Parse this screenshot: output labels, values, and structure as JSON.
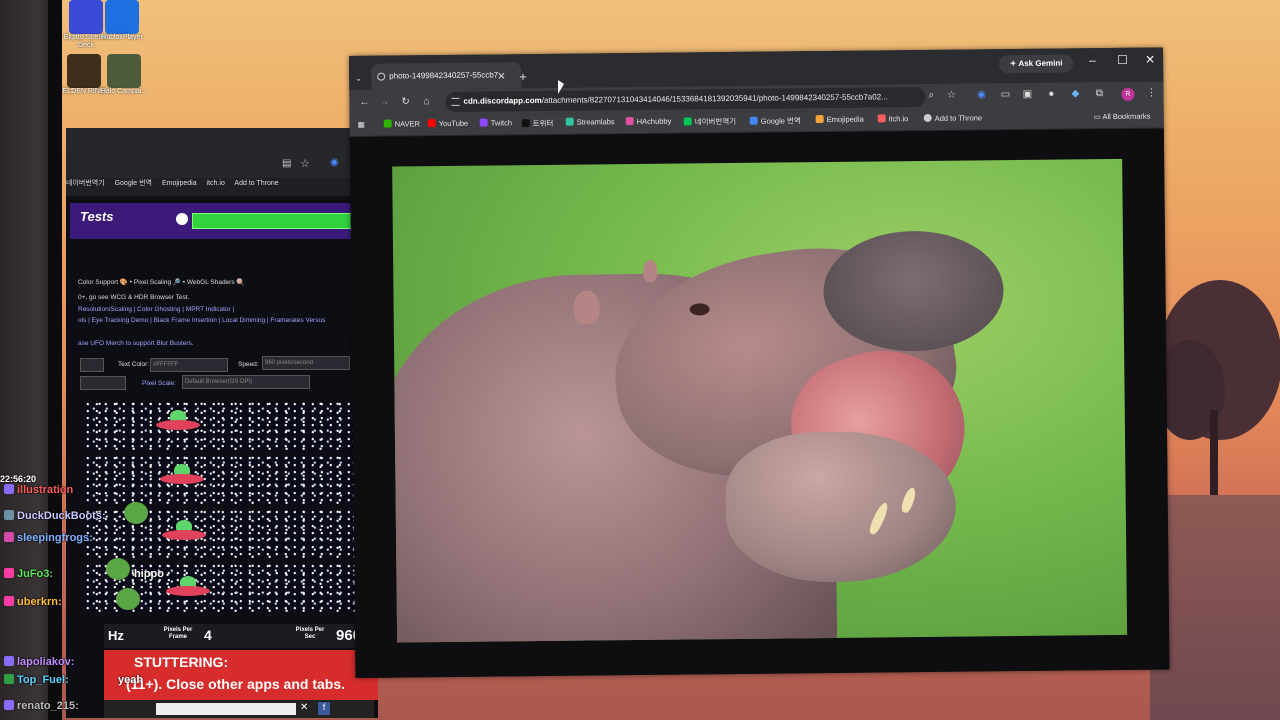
{
  "desktop": {
    "icons": [
      {
        "label": "Elgato Stream Deck"
      },
      {
        "label": "RobloxPlayer"
      },
      {
        "label": "ELDEN RING"
      },
      {
        "label": "Halo Campai..."
      }
    ]
  },
  "left_window": {
    "bookmarks": [
      "네이버번역기",
      "Google 번역",
      "Emojipedia",
      "itch.io",
      "Add to Throne"
    ],
    "title": "Tests",
    "lines": [
      "Color Support 🎨 • Pixel Scaling 🔎 • WebGL Shaders 🍭",
      "0+, go see WCG & HDR Browser Test.",
      "Resolution/Scaling | Color Ghosting | MPRT Indicator |",
      "ols | Eye Tracking Demo | Black Frame Insertion | Local Dimming | Framerates Versus",
      "ase UFO Merch to support Blur Busters."
    ],
    "text_color_label": "Text Color:",
    "text_color_value": "#FFFFFF",
    "speed_label": "Speed:",
    "speed_value": "960 pixels/second",
    "pixel_scale_label": "Pixel Scale:",
    "pixel_scale_value": "Default Browser(OS DPI)",
    "stats": {
      "hz": "Hz",
      "ppf_label": "Pixels Per Frame",
      "ppf_value": "4",
      "pps_label": "Pixels Per Sec",
      "pps_value": "960"
    },
    "banner_line1": "STUTTERING:",
    "banner_line2": "(11+). Close other apps and tabs."
  },
  "browser": {
    "tab_title": "photo-1499842340257-55ccb7",
    "ask_gemini": "Ask Gemini",
    "url_host": "cdn.discordapp.com",
    "url_path": "/attachments/822707131043414046/1533684181392035941/photo-1499842340257-55ccb7a02...",
    "avatar_letter": "R",
    "bookmarks": [
      {
        "label": "NAVER",
        "color": "#2db400"
      },
      {
        "label": "YouTube",
        "color": "#ff0000"
      },
      {
        "label": "Twitch",
        "color": "#9146ff"
      },
      {
        "label": "트위터",
        "color": "#111111"
      },
      {
        "label": "Streamlabs",
        "color": "#31c3a2"
      },
      {
        "label": "HAchubby",
        "color": "#e14fa0"
      },
      {
        "label": "네이버번역기",
        "color": "#03c75a"
      },
      {
        "label": "Google 번역",
        "color": "#4285f4"
      },
      {
        "label": "Emojipedia",
        "color": "#f3a33a"
      },
      {
        "label": "itch.io",
        "color": "#fa5c5c"
      },
      {
        "label": "Add to Throne",
        "color": "#cccccc"
      }
    ],
    "all_bookmarks": "All Bookmarks"
  },
  "chat": {
    "time": "22:56:20",
    "messages": [
      {
        "user": "illustration",
        "color": "#ff5a5a"
      },
      {
        "user": "DuckDuckBoots:",
        "color": "#c7c7ff"
      },
      {
        "user": "sleepingfrogs:",
        "color": "#7fb2ff"
      },
      {
        "user": "JuFo3:",
        "color": "#5fe35f"
      },
      {
        "user": "uberkrn:",
        "color": "#ffbf3f"
      },
      {
        "user": "lapoliakov:",
        "color": "#c08aff"
      },
      {
        "user": "Top_Fuel:",
        "color": "#5ad2ff"
      },
      {
        "user": "renato_215:",
        "color": "#bbbbbb"
      }
    ],
    "texts": {
      "hippo": "hippo",
      "yeah": "yeah"
    }
  }
}
